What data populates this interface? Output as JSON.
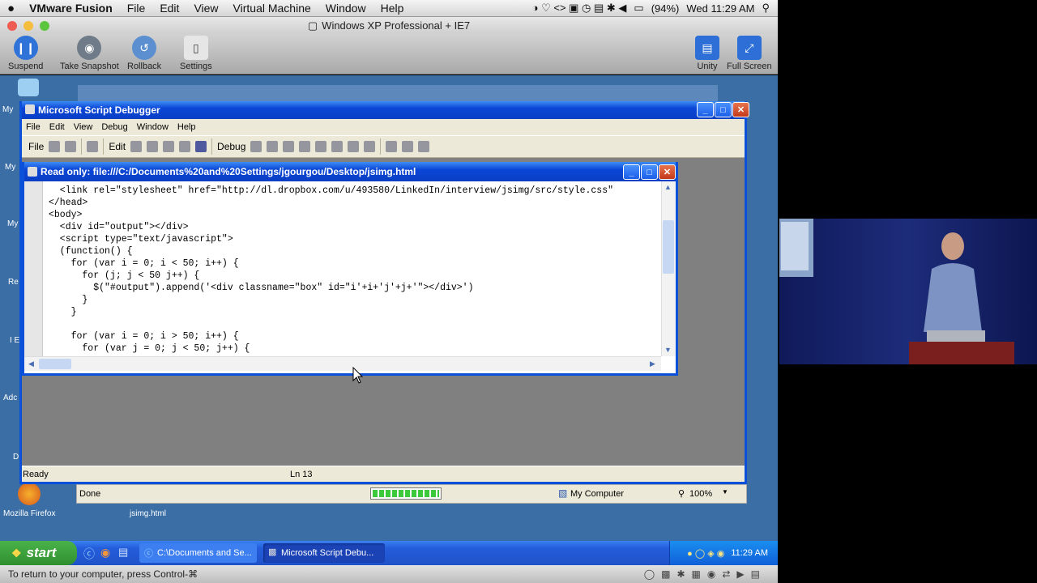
{
  "mac_menubar": {
    "apple": "",
    "app": "VMware Fusion",
    "items": [
      "File",
      "Edit",
      "View",
      "Virtual Machine",
      "Window",
      "Help"
    ],
    "battery": "(94%)",
    "clock": "Wed 11:29 AM"
  },
  "fusion": {
    "window_title": "Windows XP Professional + IE7",
    "toolbar": {
      "suspend": "Suspend",
      "snapshot": "Take Snapshot",
      "rollback": "Rollback",
      "settings": "Settings",
      "unity": "Unity",
      "fullscreen": "Full Screen"
    }
  },
  "desktop": {
    "icons": [
      "Mozilla Firefox",
      "jsimg.html"
    ],
    "left_labels": [
      "My",
      "My",
      "My",
      "Re",
      "I E",
      "Adc",
      "D M"
    ]
  },
  "debugger": {
    "title": "Microsoft Script Debugger",
    "menu": [
      "File",
      "Edit",
      "View",
      "Debug",
      "Window",
      "Help"
    ],
    "toolbar": {
      "file": "File",
      "edit": "Edit",
      "debug": "Debug"
    },
    "status": {
      "ready": "Ready",
      "line": "Ln 13"
    },
    "doc": {
      "title": "Read only: file:///C:/Documents%20and%20Settings/jgourgou/Desktop/jsimg.html",
      "code": [
        "  <link rel=\"stylesheet\" href=\"http://dl.dropbox.com/u/493580/LinkedIn/interview/jsimg/src/style.css\"",
        "</head>",
        "<body>",
        "  <div id=\"output\"></div>",
        "  <script type=\"text/javascript\">",
        "  (function() {",
        "    for (var i = 0; i < 50; i++) {",
        "      for (j; j < 50 j++) {",
        "        $(\"#output\").append('<div classname=\"box\" id=\"i'+i+'j'+j+'\"></div>')",
        "      }",
        "    }",
        "",
        "    for (var i = 0; i > 50; i++) {",
        "      for (var j = 0; j < 50; j++) {"
      ]
    }
  },
  "ie_status": {
    "text": "Done",
    "zone": "My Computer",
    "zoom": "100%"
  },
  "taskbar": {
    "start": "start",
    "tasks": [
      "C:\\Documents and Se...",
      "Microsoft Script Debu..."
    ],
    "clock": "11:29 AM"
  },
  "bottom_hint": "To return to your computer, press Control-⌘"
}
